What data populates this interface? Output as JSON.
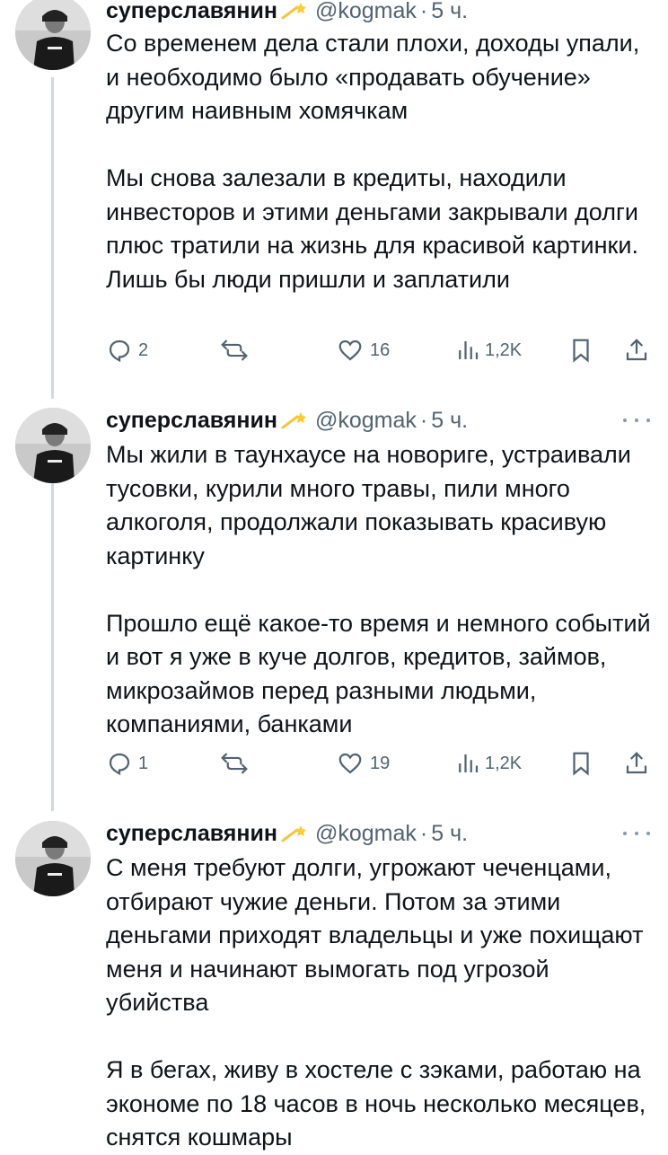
{
  "tweets": [
    {
      "name": "суперславянин",
      "handle": "@kogmak",
      "time": "5 ч.",
      "paragraphs": [
        "Со временем дела стали плохи, доходы упали, и необходимо было «продавать обучение» другим наивным хомячкам",
        "Мы снова залезали в кредиты, находили инвесторов и этими деньгами закрывали долги плюс тратили на жизнь для красивой картинки. Лишь бы люди пришли и заплатили"
      ],
      "replies": "2",
      "retweets": "",
      "likes": "16",
      "views": "1,2K"
    },
    {
      "name": "суперславянин",
      "handle": "@kogmak",
      "time": "5 ч.",
      "paragraphs": [
        "Мы жили в таунхаусе на новориге, устраивали тусовки, курили много травы, пили много алкоголя, продолжали показывать красивую картинку",
        "Прошло ещё какое-то время и немного событий и вот я уже в куче долгов, кредитов, займов, микрозаймов перед разными людьми, компаниями, банками"
      ],
      "replies": "1",
      "retweets": "",
      "likes": "19",
      "views": "1,2K"
    },
    {
      "name": "суперславянин",
      "handle": "@kogmak",
      "time": "5 ч.",
      "paragraphs": [
        "С меня требуют долги, угрожают чеченцами, отбирают чужие деньги. Потом за этими деньгами приходят владельцы и уже похищают меня и начинают вымогать под угрозой убийства",
        "Я в бегах, живу в хостеле с зэками, работаю на экономе по 18 часов в ночь несколько месяцев, снятся кошмары"
      ]
    }
  ],
  "colors": {
    "text": "#0f1419",
    "secondary": "#536471",
    "thread_line": "#cfd9de"
  },
  "icons": {
    "badge": "shooting-star-emoji",
    "reply": "reply-icon",
    "retweet": "retweet-icon",
    "like": "heart-icon",
    "views": "views-icon",
    "bookmark": "bookmark-icon",
    "share": "share-icon"
  }
}
